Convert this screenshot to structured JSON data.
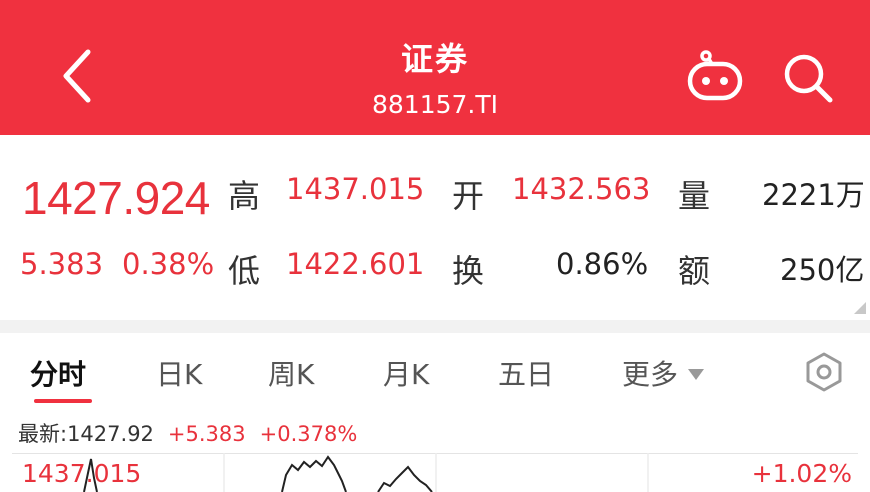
{
  "header": {
    "title": "证券",
    "code": "881157.TI"
  },
  "quote": {
    "price": "1427.924",
    "change": "5.383",
    "change_pct": "0.38%",
    "high_label": "高",
    "high": "1437.015",
    "low_label": "低",
    "low": "1422.601",
    "open_label": "开",
    "open": "1432.563",
    "turnover_label": "换",
    "turnover": "0.86%",
    "volume_label": "量",
    "volume": "2221万",
    "amount_label": "额",
    "amount": "250亿"
  },
  "tabs": [
    {
      "label": "分时"
    },
    {
      "label": "日K"
    },
    {
      "label": "周K"
    },
    {
      "label": "月K"
    },
    {
      "label": "五日"
    },
    {
      "label": "更多"
    }
  ],
  "chart_info": {
    "latest_text": "最新:1427.92",
    "latest_change": "+5.383",
    "latest_change_pct": "+0.378%",
    "y_top": "1437.015",
    "pct_top": "+1.02%"
  },
  "colors": {
    "header_bg": "#f0313f",
    "up": "#e8323c"
  },
  "icons": {
    "back": "chevron-left-icon",
    "assistant": "robot-icon",
    "search": "search-icon",
    "settings": "hexagon-settings-icon",
    "more": "caret-down-icon"
  }
}
